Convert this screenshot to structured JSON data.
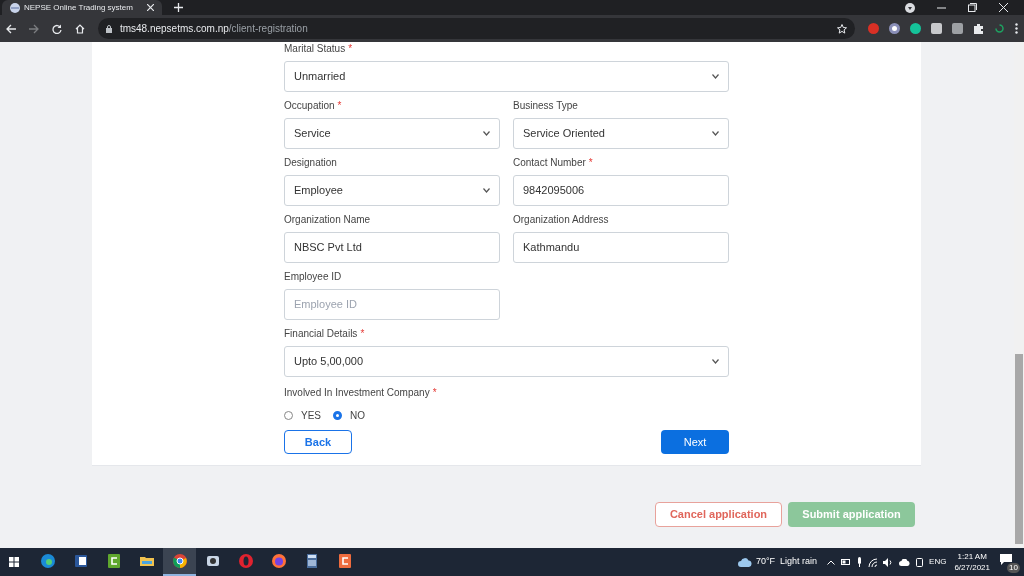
{
  "browser": {
    "tab_title": "NEPSE Online Trading system",
    "url_host": "tms48.nepsetms.com.np",
    "url_path": "/client-registration"
  },
  "form": {
    "fields": [
      {
        "kind": "select",
        "label": "Marital Status",
        "required": true,
        "wide": true,
        "value": "Unmarried"
      },
      {
        "kind": "select",
        "label": "Occupation",
        "required": true,
        "wide": false,
        "value": "Service"
      },
      {
        "kind": "select",
        "label": "Business Type",
        "required": false,
        "wide": false,
        "value": "Service Oriented"
      },
      {
        "kind": "select",
        "label": "Designation",
        "required": false,
        "wide": false,
        "value": "Employee"
      },
      {
        "kind": "input",
        "label": "Contact Number",
        "required": true,
        "wide": false,
        "value": "9842095006"
      },
      {
        "kind": "input",
        "label": "Organization Name",
        "required": false,
        "wide": false,
        "value": "NBSC Pvt Ltd"
      },
      {
        "kind": "input",
        "label": "Organization Address",
        "required": false,
        "wide": false,
        "value": "Kathmandu"
      },
      {
        "kind": "input",
        "label": "Employee ID",
        "required": false,
        "wide": false,
        "placeholder": "Employee ID"
      },
      {
        "kind": "select",
        "label": "Financial Details",
        "required": true,
        "wide": true,
        "value": "Upto 5,00,000"
      }
    ],
    "required_mark": "*",
    "radio_group": {
      "label": "Involved In Investment Company",
      "required": true,
      "options": [
        {
          "label": "YES",
          "selected": false
        },
        {
          "label": "NO",
          "selected": true
        }
      ]
    },
    "back_button": "Back",
    "next_button": "Next"
  },
  "actions": {
    "cancel": "Cancel application",
    "submit": "Submit application"
  },
  "taskbar": {
    "apps": [
      {
        "kind": "edge",
        "selected": false
      },
      {
        "kind": "word",
        "selected": false
      },
      {
        "kind": "camtasia",
        "selected": false
      },
      {
        "kind": "folder",
        "selected": false
      },
      {
        "kind": "chrome",
        "selected": true
      },
      {
        "kind": "recorder",
        "selected": false
      },
      {
        "kind": "opera",
        "selected": false
      },
      {
        "kind": "firefox",
        "selected": false
      },
      {
        "kind": "calculator",
        "selected": false
      },
      {
        "kind": "editor",
        "selected": false
      }
    ],
    "temperature": "70°F",
    "weather": "Light rain",
    "language": "ENG",
    "time": "1:21 AM",
    "date": "6/27/2021",
    "notifications": "10"
  }
}
